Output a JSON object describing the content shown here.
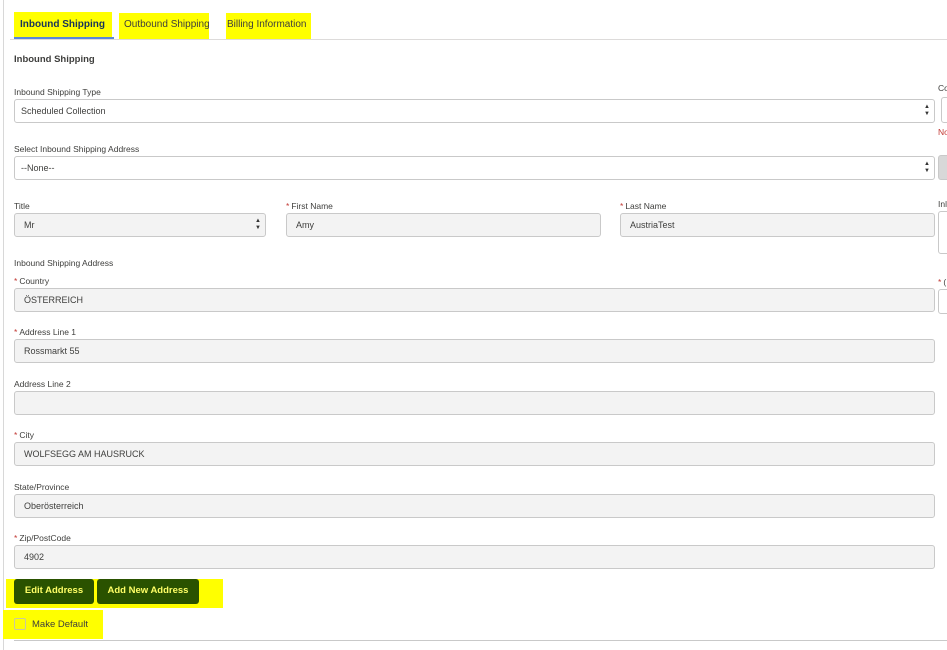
{
  "tabs": [
    {
      "label": "Inbound Shipping",
      "active": true
    },
    {
      "label": "Outbound Shipping"
    },
    {
      "label": "Billing Information"
    }
  ],
  "section_title": "Inbound Shipping",
  "fields": {
    "shipping_type": {
      "label": "Inbound Shipping Type",
      "value": "Scheduled Collection"
    },
    "select_address": {
      "label": "Select Inbound Shipping Address",
      "value": "--None--"
    },
    "title": {
      "label": "Title",
      "value": "Mr"
    },
    "first_name": {
      "label": "First Name",
      "value": "Amy"
    },
    "last_name": {
      "label": "Last Name",
      "value": "AustriaTest"
    },
    "address_heading": "Inbound Shipping Address",
    "country": {
      "label": "Country",
      "value": "ÖSTERREICH"
    },
    "address1": {
      "label": "Address Line 1",
      "value": "Rossmarkt 55"
    },
    "address2": {
      "label": "Address Line 2",
      "value": ""
    },
    "city": {
      "label": "City",
      "value": "WOLFSEGG AM HAUSRUCK"
    },
    "state": {
      "label": "State/Province",
      "value": "Oberösterreich"
    },
    "zip": {
      "label": "Zip/PostCode",
      "value": "4902"
    }
  },
  "required_mark": "*",
  "right_clipped": {
    "label1": "Co",
    "error": "No",
    "label2": "Inl",
    "label3": "("
  },
  "buttons": {
    "edit": "Edit Address",
    "add": "Add New Address"
  },
  "make_default": {
    "label": "Make Default",
    "checked": false
  },
  "colors": {
    "highlight": "#ffff00",
    "button": "#2a5200",
    "error": "#c23934"
  }
}
